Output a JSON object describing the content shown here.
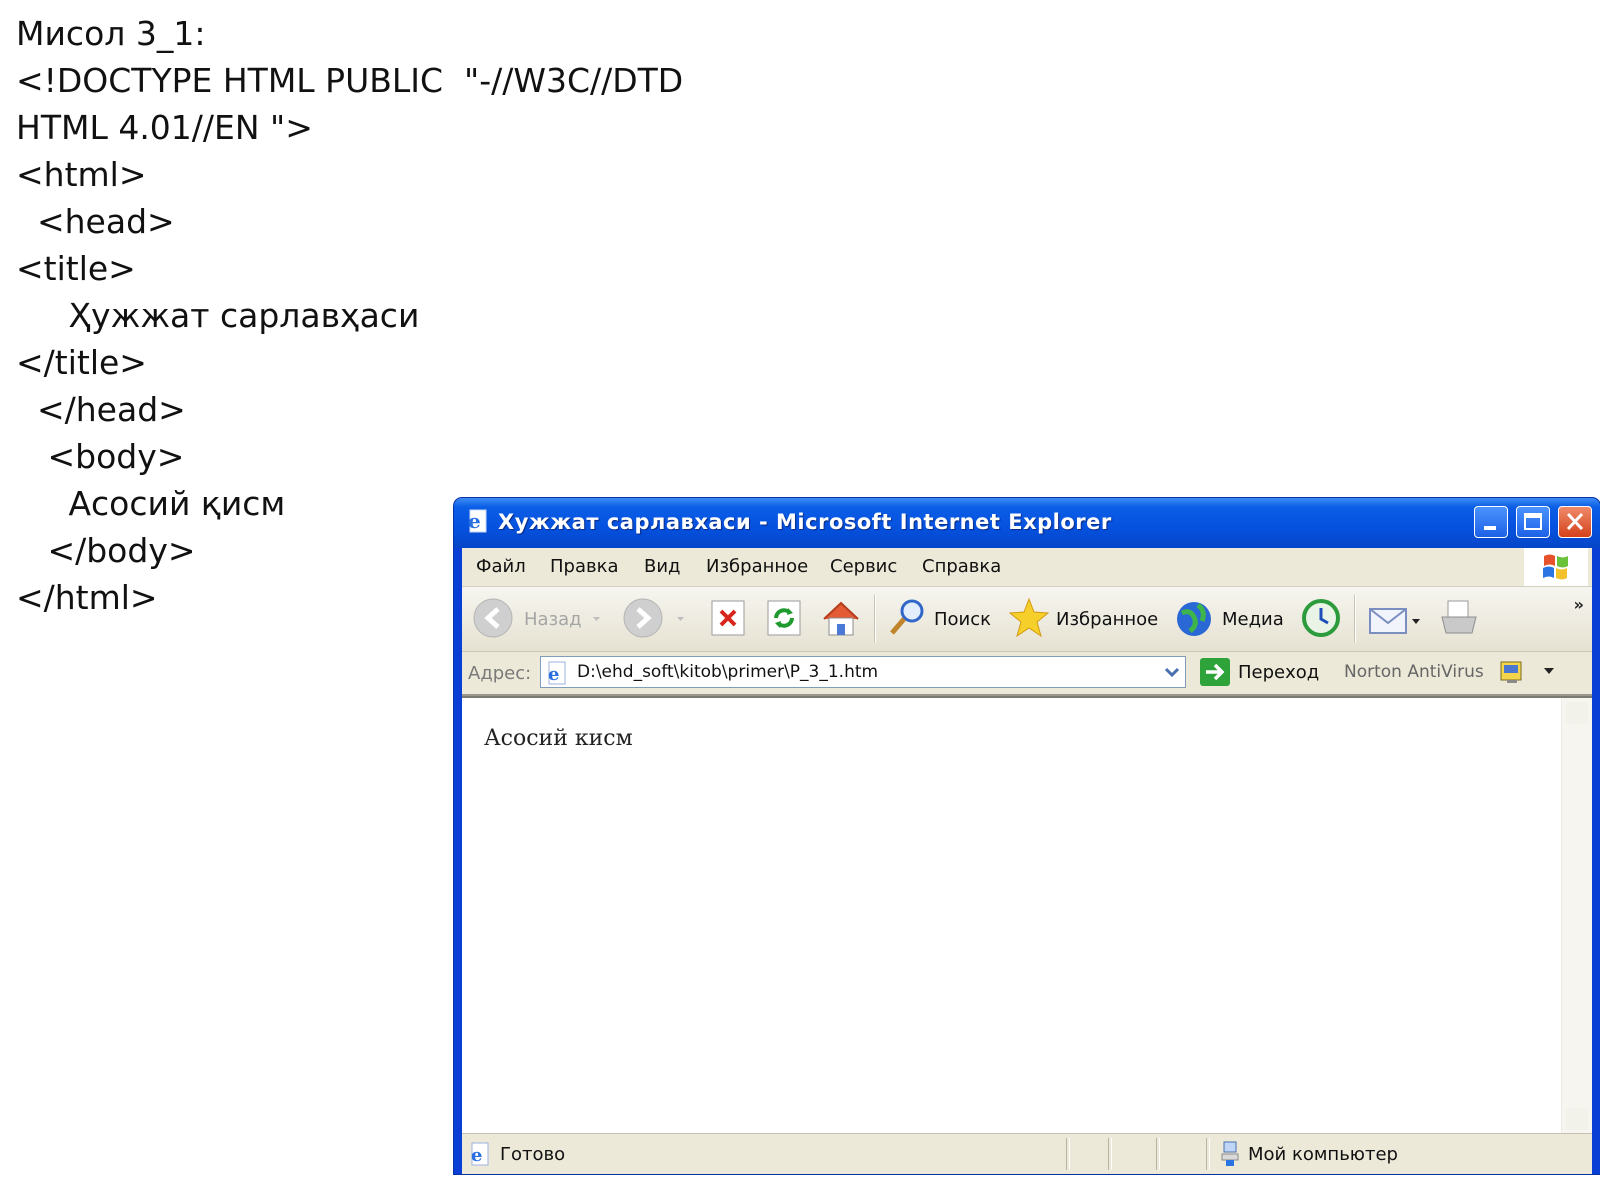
{
  "slide": {
    "heading": "Мисол 3_1:",
    "code_lines": [
      "<!DOCTYPE HTML PUBLIC  \"-//W3C//DTD",
      "HTML 4.01//EN \">",
      "<html>",
      "  <head>",
      "<title>",
      "     Ҳужжат сарлавҳаси",
      "</title>",
      "  </head>",
      "   <body>",
      "     Асосий қисм",
      "   </body>",
      "</html>"
    ]
  },
  "ie": {
    "title": "Хужжат сарлавхаси - Microsoft Internet Explorer",
    "menu": [
      "Файл",
      "Правка",
      "Вид",
      "Избранное",
      "Сервис",
      "Справка"
    ],
    "toolbar": {
      "back": "Назад",
      "search": "Поиск",
      "favorites": "Избранное",
      "media": "Медиа",
      "chevron": "»"
    },
    "address": {
      "label": "Адрес:",
      "value": "D:\\ehd_soft\\kitob\\primer\\P_3_1.htm",
      "go": "Переход",
      "norton": "Norton AntiVirus"
    },
    "content": "Асосий кисм",
    "status": {
      "text": "Готово",
      "zone": "Мой компьютер"
    }
  },
  "colors": {
    "titlebar": "#0551df",
    "window_frame": "#0a3fd6",
    "chrome": "#ece9d8"
  }
}
